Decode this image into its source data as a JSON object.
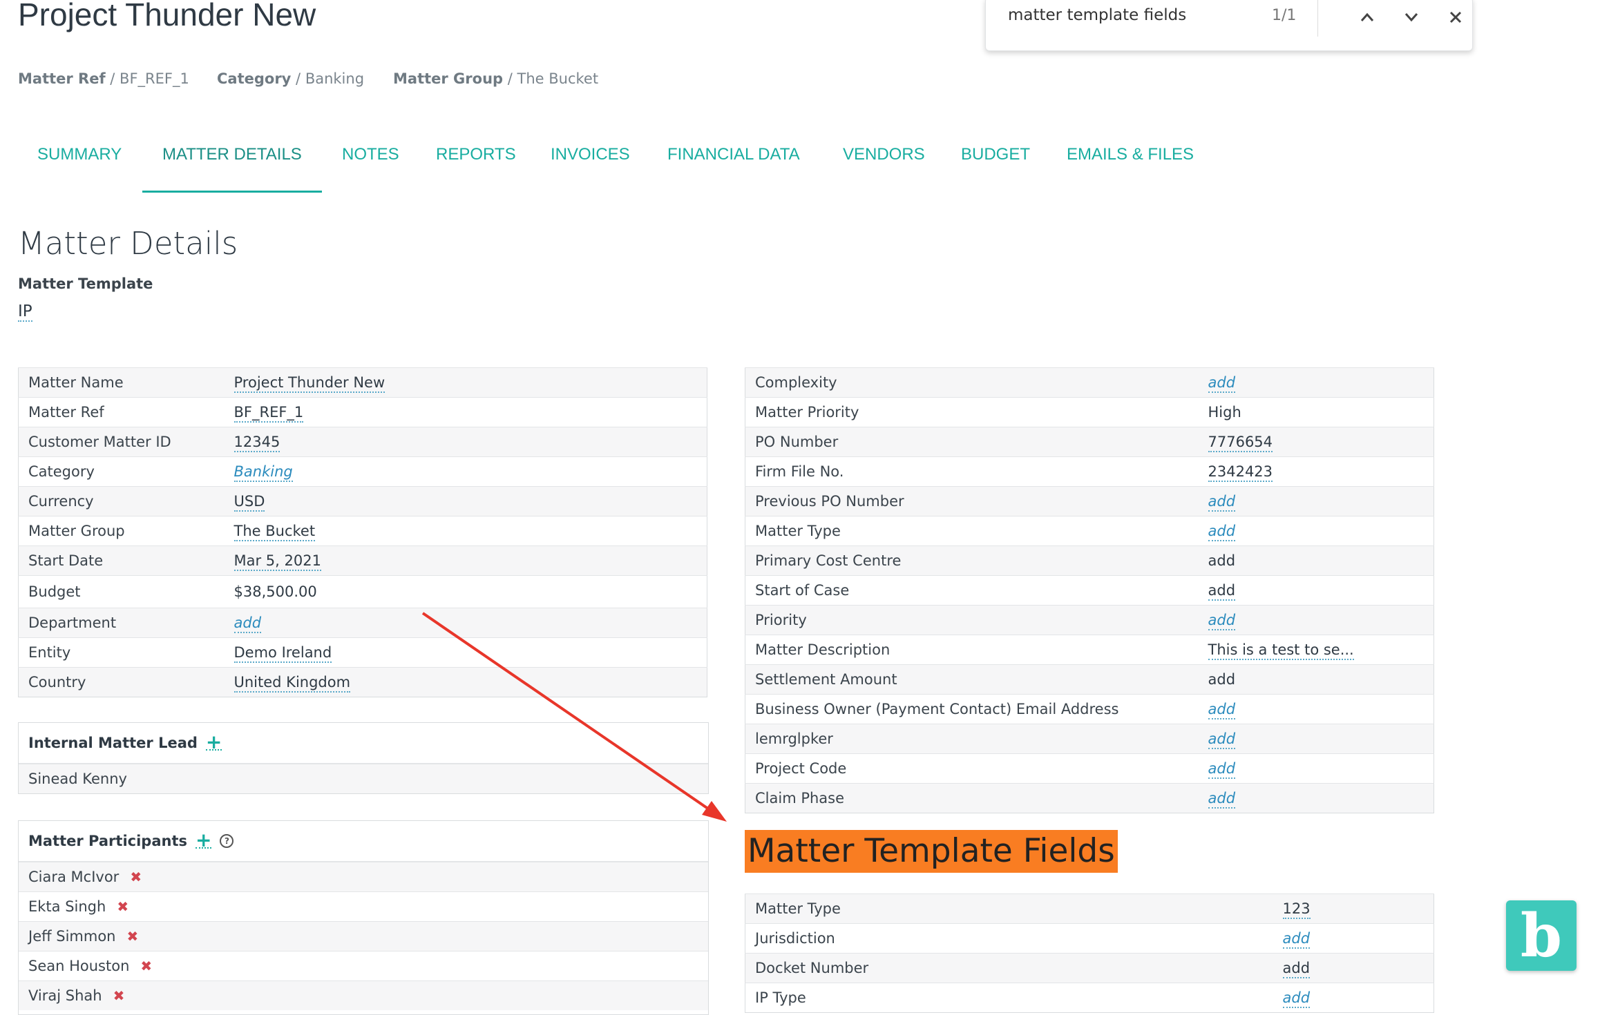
{
  "header": {
    "title": "Project Thunder New",
    "meta": [
      {
        "label": "Matter Ref",
        "value": "BF_REF_1"
      },
      {
        "label": "Category",
        "value": "Banking"
      },
      {
        "label": "Matter Group",
        "value": "The Bucket"
      }
    ]
  },
  "find_bar": {
    "query": "matter template fields",
    "count": "1/1"
  },
  "tabs": [
    "SUMMARY",
    "MATTER DETAILS",
    "NOTES",
    "REPORTS",
    "INVOICES",
    "FINANCIAL DATA",
    "VENDORS",
    "BUDGET",
    "EMAILS & FILES"
  ],
  "active_tab": "MATTER DETAILS",
  "section": {
    "title": "Matter Details",
    "template_label": "Matter Template",
    "template_value": "IP"
  },
  "left_table": [
    {
      "label": "Matter Name",
      "value": "Project Thunder New"
    },
    {
      "label": "Matter Ref",
      "value": "BF_REF_1"
    },
    {
      "label": "Customer Matter ID",
      "value": "12345"
    },
    {
      "label": "Category",
      "value": "Banking"
    },
    {
      "label": "Currency",
      "value": "USD"
    },
    {
      "label": "Matter Group",
      "value": "The Bucket"
    },
    {
      "label": "Start Date",
      "value": "Mar 5, 2021"
    },
    {
      "label": "Budget",
      "value": "$38,500.00"
    },
    {
      "label": "Department",
      "value": "add"
    },
    {
      "label": "Entity",
      "value": "Demo Ireland"
    },
    {
      "label": "Country",
      "value": "United Kingdom"
    }
  ],
  "internal_lead": {
    "title": "Internal Matter Lead",
    "name": "Sinead Kenny"
  },
  "participants": {
    "title": "Matter Participants",
    "names": [
      "Ciara McIvor",
      "Ekta Singh",
      "Jeff Simmon",
      "Sean Houston",
      "Viraj Shah"
    ]
  },
  "right_table": [
    {
      "label": "Complexity",
      "value": "add"
    },
    {
      "label": "Matter Priority",
      "value": "High"
    },
    {
      "label": "PO Number",
      "value": "7776654"
    },
    {
      "label": "Firm File No.",
      "value": "2342423"
    },
    {
      "label": "Previous PO Number",
      "value": "add"
    },
    {
      "label": "Matter Type",
      "value": "add"
    },
    {
      "label": "Primary Cost Centre",
      "value": "add"
    },
    {
      "label": "Start of Case",
      "value": "add"
    },
    {
      "label": "Priority",
      "value": "add"
    },
    {
      "label": "Matter Description",
      "value": "This is a test to se..."
    },
    {
      "label": "Settlement Amount",
      "value": "add"
    },
    {
      "label": "Business Owner (Payment Contact) Email Address",
      "value": "add"
    },
    {
      "label": "lemrglpker",
      "value": "add"
    },
    {
      "label": "Project Code",
      "value": "add"
    },
    {
      "label": "Claim Phase",
      "value": "add"
    }
  ],
  "template_fields": {
    "title": "Matter Template Fields",
    "rows": [
      {
        "label": "Matter Type",
        "value": "123"
      },
      {
        "label": "Jurisdiction",
        "value": "add"
      },
      {
        "label": "Docket Number",
        "value": "add"
      },
      {
        "label": "IP Type",
        "value": "add"
      }
    ]
  },
  "fab_letter": "b",
  "colors": {
    "accent": "#19ada0",
    "highlight": "#f97d22",
    "arrow": "#e8362a",
    "link": "#2b8bbd",
    "remove": "#d2454f"
  }
}
